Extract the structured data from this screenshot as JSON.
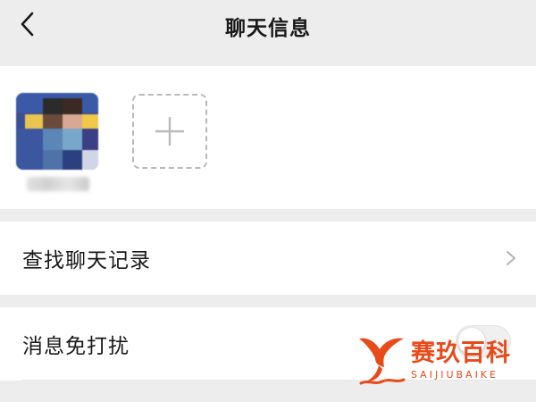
{
  "nav": {
    "title": "聊天信息",
    "back_icon": "chevron-left-icon"
  },
  "members": {
    "add_icon": "plus-icon"
  },
  "rows": [
    {
      "label": "查找聊天记录",
      "icon": "chevron-right-icon"
    },
    {
      "label": "消息免打扰",
      "control": "toggle",
      "state": "off"
    }
  ],
  "watermark": {
    "cn": "赛玖百科",
    "en": "SAIJIUBAIKE",
    "color": "#e84a1a"
  },
  "colors": {
    "background": "#ededed",
    "surface": "#ffffff",
    "text": "#191919",
    "icon_gray": "#b9b9b9"
  }
}
